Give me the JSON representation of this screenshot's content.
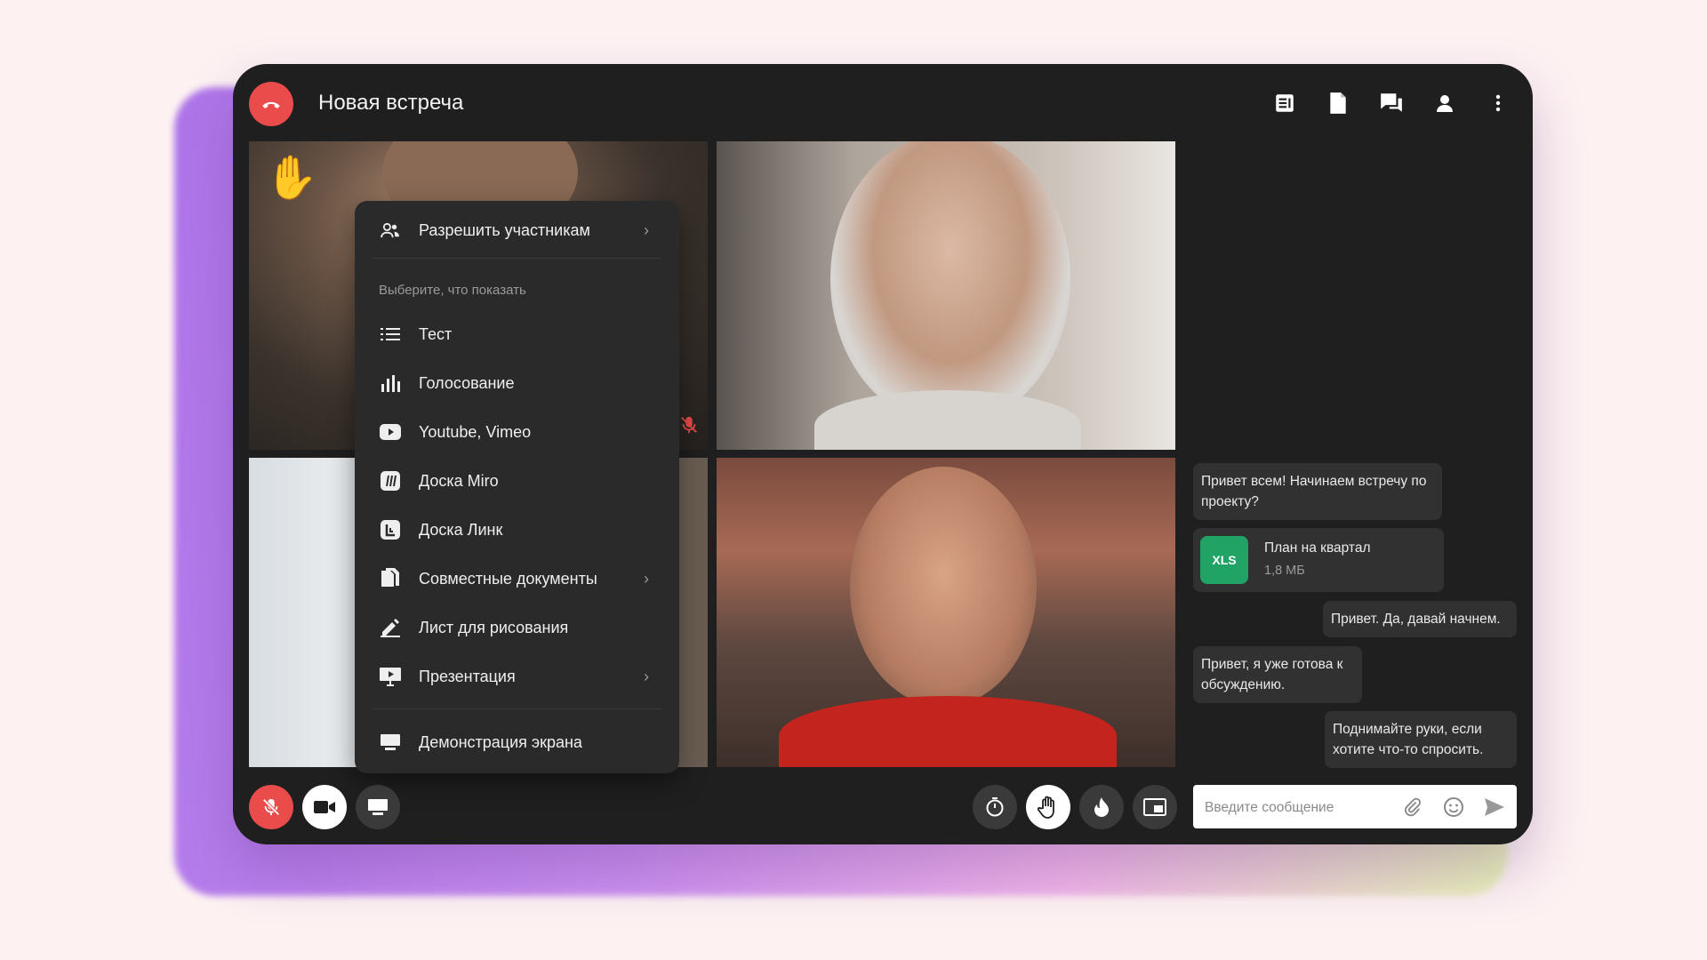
{
  "meeting": {
    "title": "Новая встреча"
  },
  "menu": {
    "allow_participants": "Разрешить участникам",
    "hint": "Выберите, что показать",
    "items": [
      {
        "label": "Тест",
        "icon": "list-icon"
      },
      {
        "label": "Голосование",
        "icon": "bar-chart-icon"
      },
      {
        "label": "Youtube, Vimeo",
        "icon": "youtube-icon"
      },
      {
        "label": "Доска Miro",
        "icon": "miro-icon"
      },
      {
        "label": "Доска Линк",
        "icon": "link-board-icon"
      },
      {
        "label": "Совместные документы",
        "icon": "documents-icon"
      },
      {
        "label": "Лист для рисования",
        "icon": "pencil-icon"
      },
      {
        "label": "Презентация",
        "icon": "presentation-icon"
      }
    ],
    "screen_share": "Демонстрация экрана"
  },
  "chat": {
    "messages": [
      {
        "text": "Привет всем! Начинаем встречу по проекту?"
      },
      {
        "file_type": "XLS",
        "file_name": "План на квартал",
        "file_size": "1,8 МБ"
      },
      {
        "text": "Привет. Да, давай начнем."
      },
      {
        "text": "Привет, я уже готова к обсуждению."
      },
      {
        "text": "Поднимайте руки, если хотите что-то спросить."
      }
    ],
    "input_placeholder": "Введите сообщение"
  },
  "colors": {
    "accent_red": "#ea4b4b",
    "background": "#1f1f1f",
    "xls_green": "#21a366"
  }
}
